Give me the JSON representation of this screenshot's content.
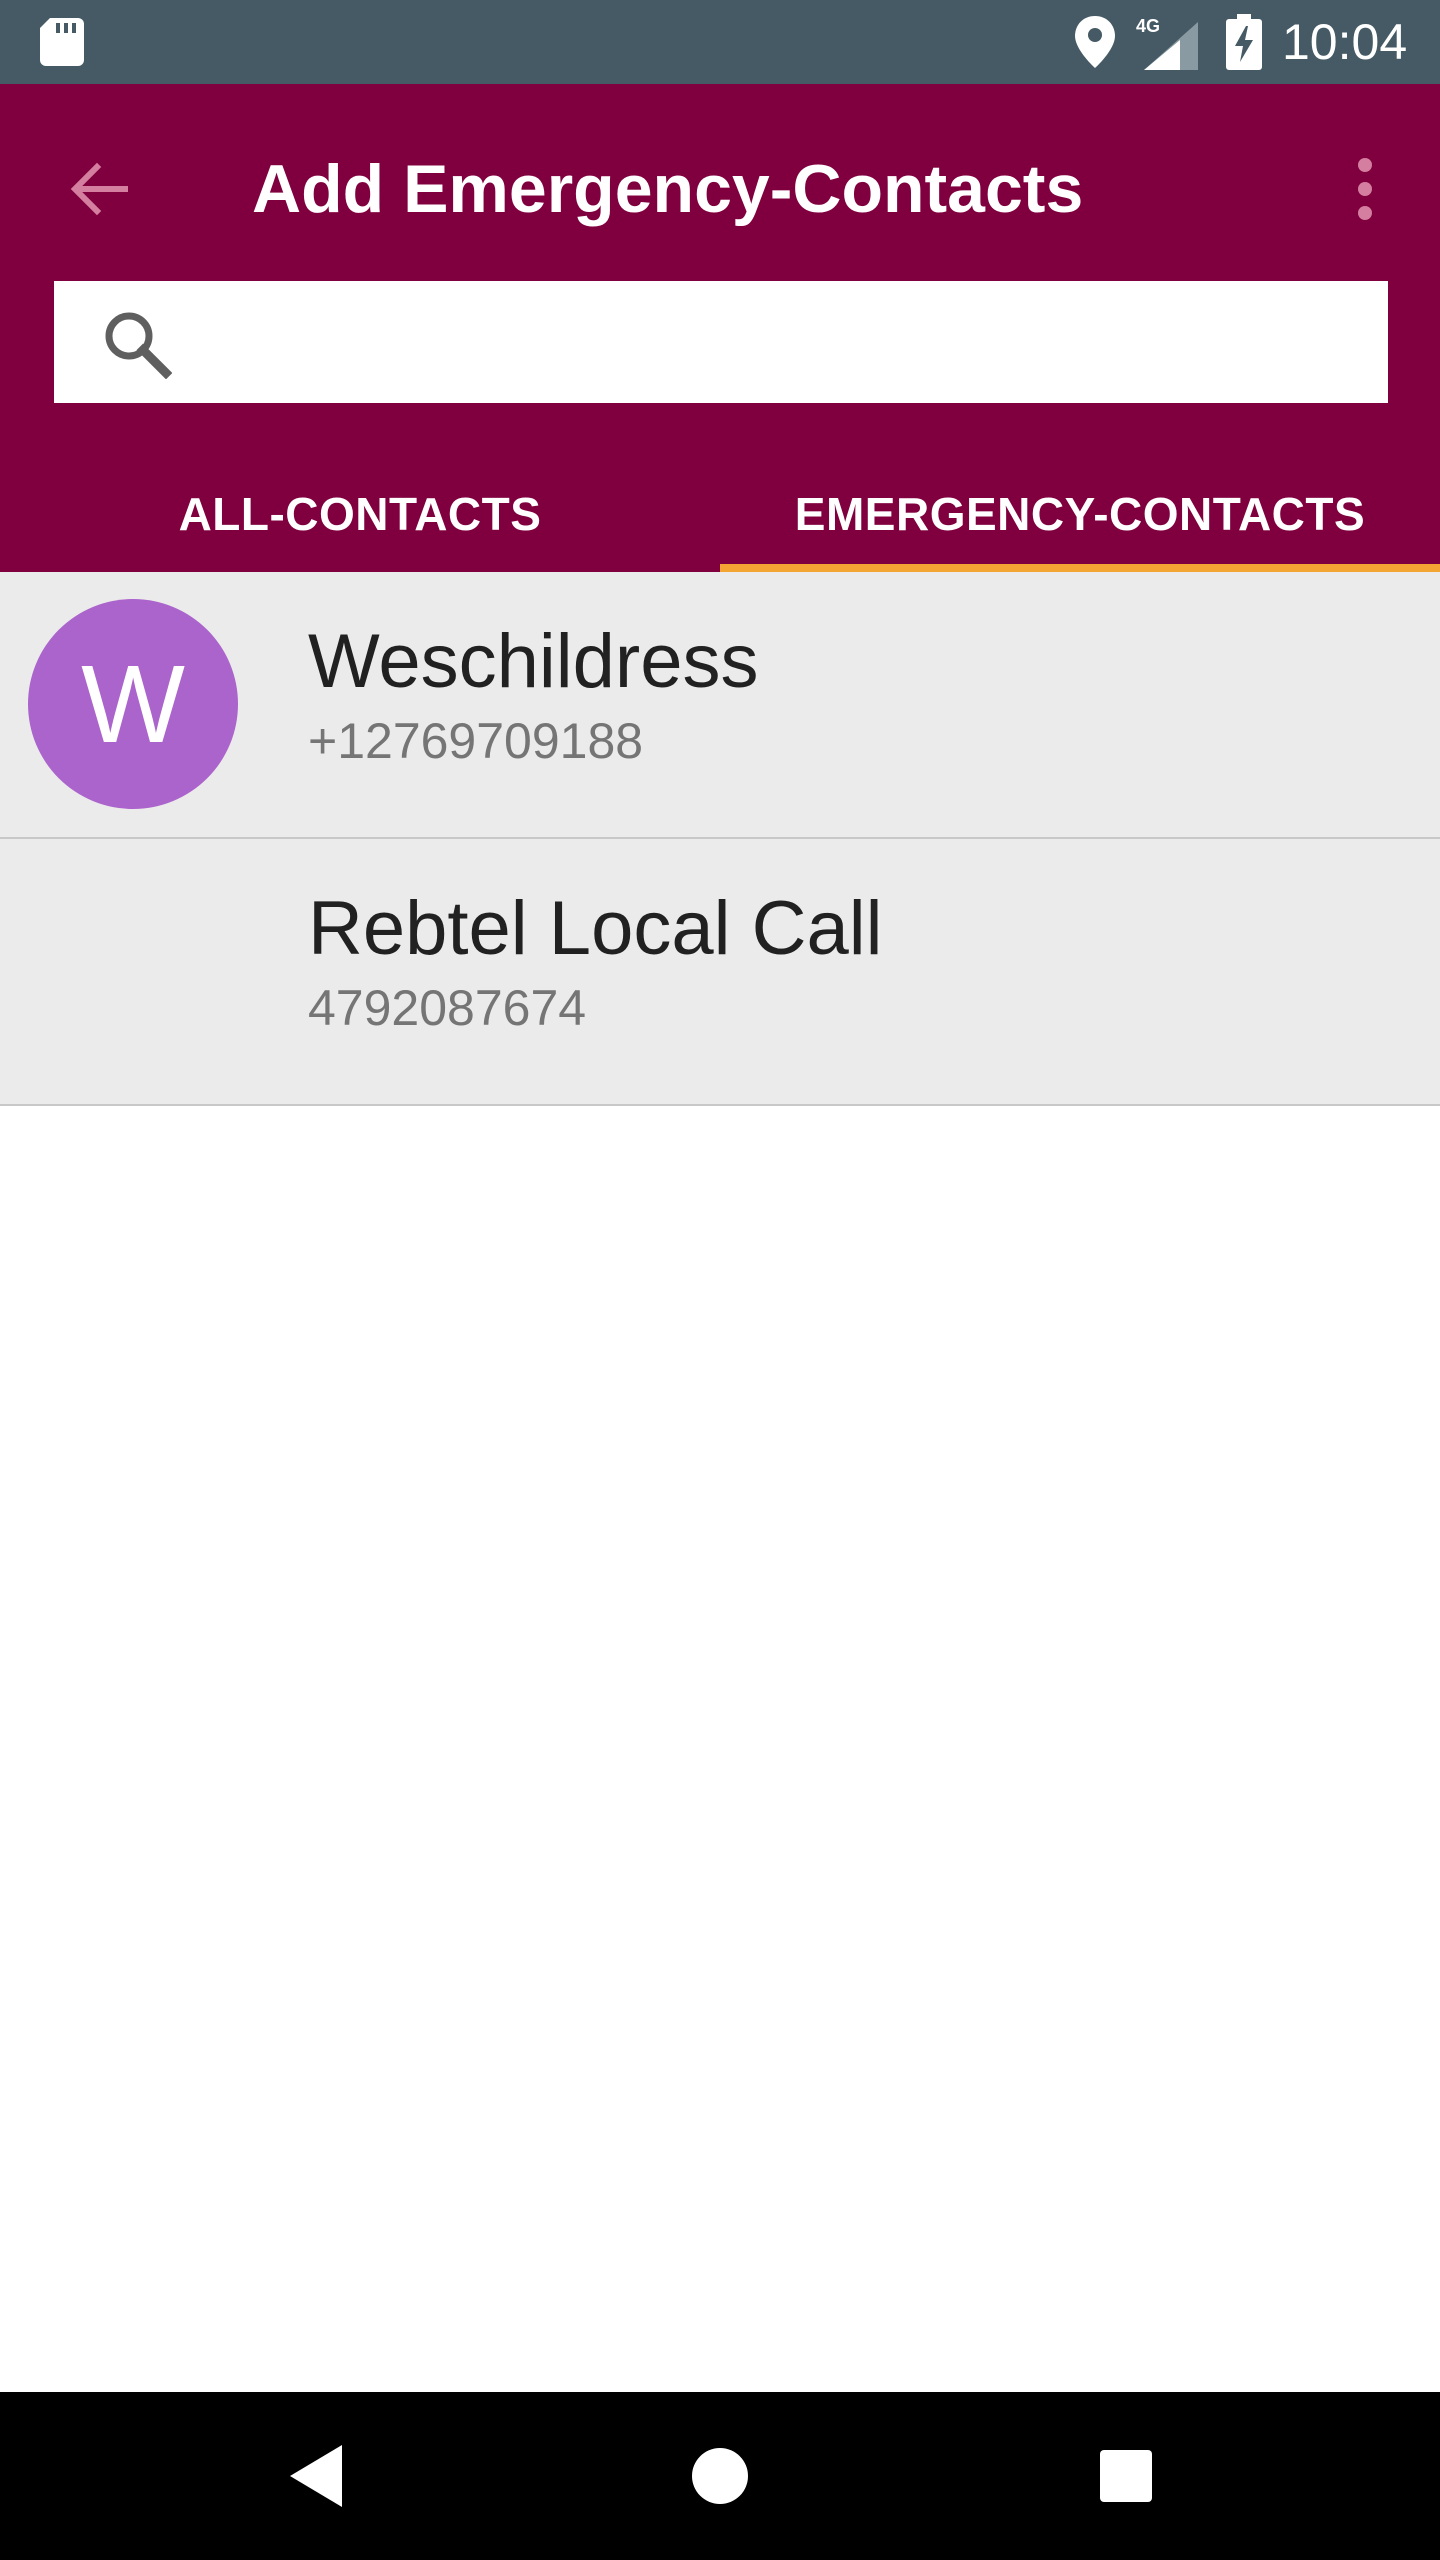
{
  "status_bar": {
    "time": "10:04",
    "network": "4G",
    "icons": [
      "sd-card-icon",
      "location-icon",
      "signal-icon",
      "battery-charging-icon"
    ],
    "background": "#455a64"
  },
  "app_bar": {
    "title": "Add Emergency-Contacts",
    "back_icon": "arrow-back-icon",
    "overflow_icon": "more-vert-icon",
    "background": "#80003f"
  },
  "search": {
    "icon": "search-icon",
    "value": "",
    "placeholder": ""
  },
  "tabs": [
    {
      "label": "ALL-CONTACTS",
      "selected": false
    },
    {
      "label": "EMERGENCY-CONTACTS",
      "selected": true
    }
  ],
  "tab_indicator_color": "#f4a533",
  "contacts": [
    {
      "initial": "W",
      "name": "Weschildress",
      "number": "+12769709188",
      "avatar_color": "#ab64cc"
    },
    {
      "initial": "",
      "name": "Rebtel Local Call",
      "number": "4792087674"
    }
  ],
  "nav_bar": {
    "icons": [
      "nav-back-icon",
      "nav-home-icon",
      "nav-recents-icon"
    ]
  }
}
